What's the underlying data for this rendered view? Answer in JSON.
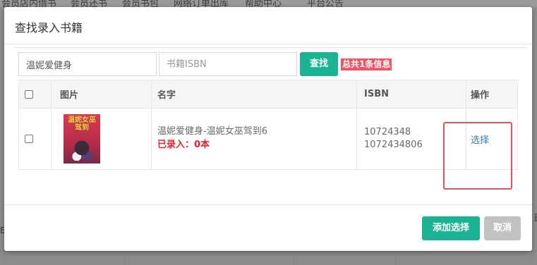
{
  "background": {
    "nav_items": [
      "会员店内借书",
      "会员还书",
      "会员书包",
      "网络订单出库",
      "帮助中心",
      "平台公告"
    ],
    "right_fragment": "畺",
    "left_fragment": "E"
  },
  "modal": {
    "title": "查找录入书籍",
    "search": {
      "name_value": "温妮爱健身",
      "isbn_placeholder": "书籍ISBN",
      "find_label": "查找",
      "total_label": "总共1条信息"
    },
    "table": {
      "headers": {
        "image": "图片",
        "name": "名字",
        "isbn": "ISBN",
        "action": "操作"
      },
      "rows": [
        {
          "cover_text": "温妮女巫驾到",
          "name": "温妮爱健身-温妮女巫驾到6",
          "recorded": "已录入：0本",
          "isbn_1": "10724348",
          "isbn_2": "1072434806",
          "action": "选择"
        }
      ]
    },
    "footer": {
      "add_label": "添加选择",
      "cancel_label": "取消"
    }
  },
  "colors": {
    "primary": "#1ab394",
    "danger": "#ed5565",
    "link": "#337ab7",
    "disabled": "#c2c2c2",
    "annotation_box": "#e8505b"
  }
}
